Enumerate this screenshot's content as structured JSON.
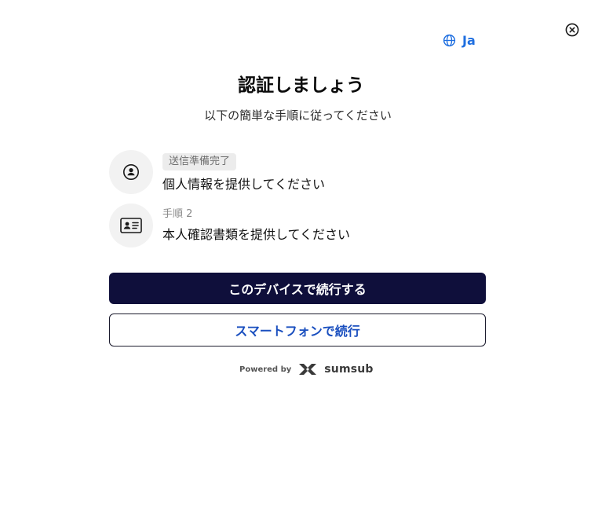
{
  "header": {
    "language_label": "Ja",
    "globe_icon": "globe-icon",
    "close_icon": "close-icon"
  },
  "main": {
    "title": "認証しましょう",
    "subtitle": "以下の簡単な手順に従ってください"
  },
  "steps": [
    {
      "icon": "user-circle-icon",
      "badge": "送信準備完了",
      "label": "個人情報を提供してください"
    },
    {
      "icon": "id-card-icon",
      "number_label": "手順 2",
      "label": "本人確認書類を提供してください"
    }
  ],
  "actions": {
    "continue_device_label": "このデバイスで続行する",
    "continue_phone_label": "スマートフォンで続行"
  },
  "footer": {
    "powered_by": "Powered by",
    "brand": "sumsub",
    "brand_icon": "sumsub-logo-icon"
  },
  "colors": {
    "accent_blue": "#1f6fe0",
    "primary_button": "#0f0f3b",
    "secondary_text": "#1a4fbf",
    "icon_bg": "#f2f2f2"
  }
}
